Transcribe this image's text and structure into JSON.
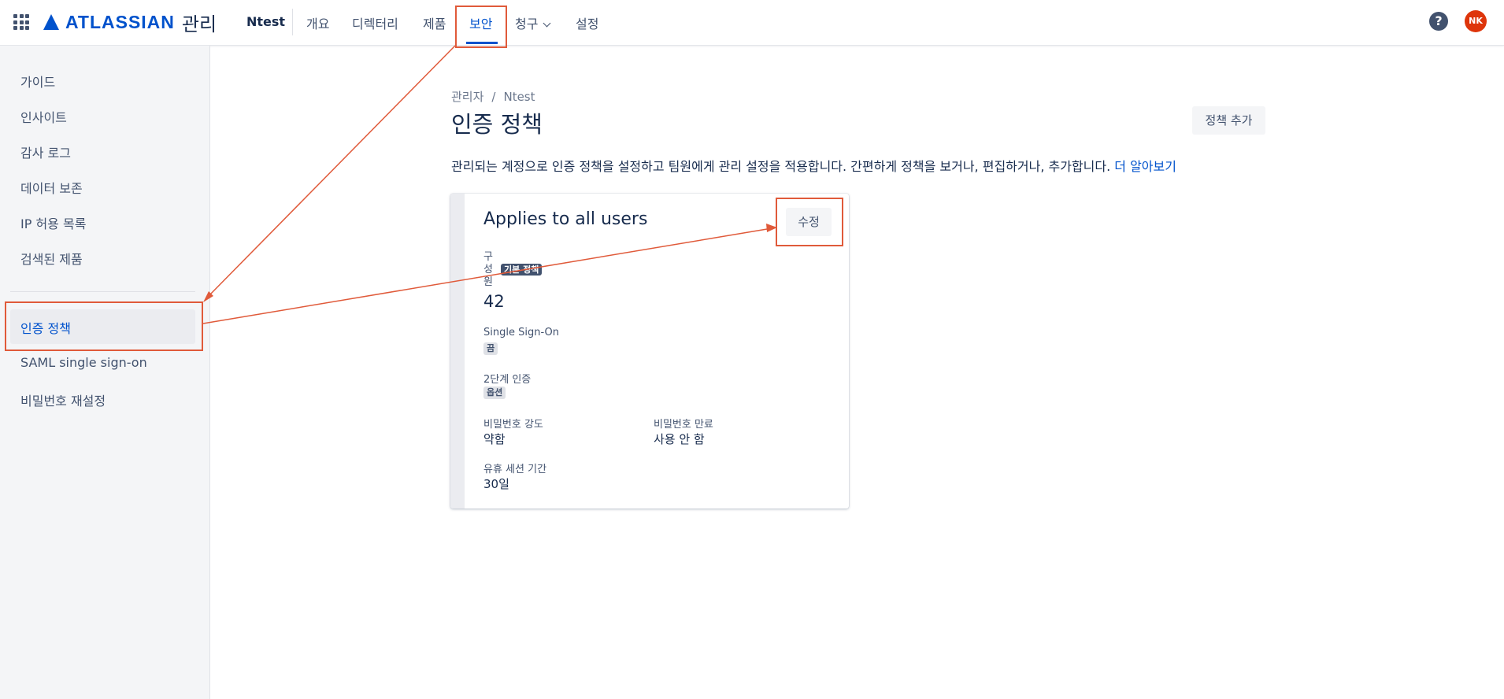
{
  "header": {
    "brand": "ATLASSIAN",
    "product": "관리",
    "org": "Ntest",
    "nav": [
      {
        "label": "개요"
      },
      {
        "label": "디렉터리"
      },
      {
        "label": "제품"
      },
      {
        "label": "보안",
        "active": true
      },
      {
        "label": "청구"
      },
      {
        "label": "설정"
      }
    ],
    "help_icon": "question-circle-icon",
    "avatar_initials": "NK"
  },
  "sidebar": {
    "items": [
      {
        "label": "가이드"
      },
      {
        "label": "인사이트"
      },
      {
        "label": "감사 로그"
      },
      {
        "label": "데이터 보존"
      },
      {
        "label": "IP 허용 목록"
      },
      {
        "label": "검색된 제품"
      },
      {
        "label": "인증 정책",
        "active": true
      },
      {
        "label": "SAML single sign-on"
      },
      {
        "label": "비밀번호 재설정"
      }
    ]
  },
  "main": {
    "breadcrumb": [
      "관리자",
      "Ntest"
    ],
    "breadcrumb_sep": "/",
    "title": "인증 정책",
    "add_button": "정책 추가",
    "description": "관리되는 계정으로 인증 정책을 설정하고 팀원에게 관리 설정을 적용합니다. 간편하게 정책을 보거나, 편집하거나, 추가합니다.",
    "learn_more": "더 알아보기"
  },
  "policy_card": {
    "title": "Applies to all users",
    "edit_button": "수정",
    "members_label": "구성원",
    "default_badge": "기본 정책",
    "members_count": "42",
    "sso_label": "Single Sign-On",
    "sso_value": "끔",
    "tfa_label": "2단계 인증",
    "tfa_value": "옵션",
    "pw_strength_label": "비밀번호 강도",
    "pw_strength_value": "약함",
    "pw_expiry_label": "비밀번호 만료",
    "pw_expiry_value": "사용 안 함",
    "idle_label": "유휴 세션 기간",
    "idle_value": "30일"
  },
  "colors": {
    "brand": "#0052CC",
    "annotation": "#E05A3A",
    "sidebar_bg": "#F4F5F7"
  }
}
